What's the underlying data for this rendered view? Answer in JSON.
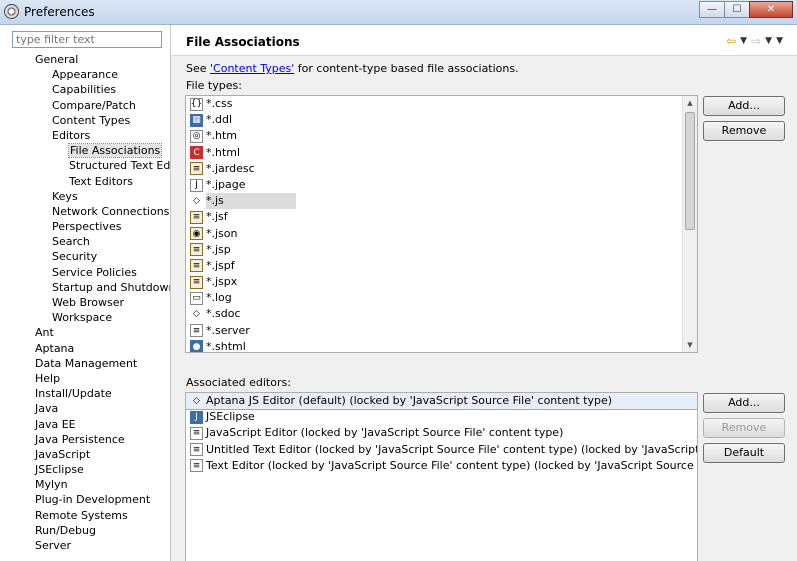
{
  "window": {
    "title": "Preferences"
  },
  "filter": {
    "placeholder": "type filter text"
  },
  "tree": [
    {
      "label": "General",
      "indent": 1
    },
    {
      "label": "Appearance",
      "indent": 2
    },
    {
      "label": "Capabilities",
      "indent": 2
    },
    {
      "label": "Compare/Patch",
      "indent": 2
    },
    {
      "label": "Content Types",
      "indent": 2
    },
    {
      "label": "Editors",
      "indent": 2
    },
    {
      "label": "File Associations",
      "indent": 3,
      "selected": true
    },
    {
      "label": "Structured Text Editors",
      "indent": 3
    },
    {
      "label": "Text Editors",
      "indent": 3
    },
    {
      "label": "Keys",
      "indent": 2
    },
    {
      "label": "Network Connections",
      "indent": 2
    },
    {
      "label": "Perspectives",
      "indent": 2
    },
    {
      "label": "Search",
      "indent": 2
    },
    {
      "label": "Security",
      "indent": 2
    },
    {
      "label": "Service Policies",
      "indent": 2
    },
    {
      "label": "Startup and Shutdown",
      "indent": 2
    },
    {
      "label": "Web Browser",
      "indent": 2
    },
    {
      "label": "Workspace",
      "indent": 2
    },
    {
      "label": "Ant",
      "indent": 1
    },
    {
      "label": "Aptana",
      "indent": 1
    },
    {
      "label": "Data Management",
      "indent": 1
    },
    {
      "label": "Help",
      "indent": 1
    },
    {
      "label": "Install/Update",
      "indent": 1
    },
    {
      "label": "Java",
      "indent": 1
    },
    {
      "label": "Java EE",
      "indent": 1
    },
    {
      "label": "Java Persistence",
      "indent": 1
    },
    {
      "label": "JavaScript",
      "indent": 1
    },
    {
      "label": "JSEclipse",
      "indent": 1
    },
    {
      "label": "Mylyn",
      "indent": 1
    },
    {
      "label": "Plug-in Development",
      "indent": 1
    },
    {
      "label": "Remote Systems",
      "indent": 1
    },
    {
      "label": "Run/Debug",
      "indent": 1
    },
    {
      "label": "Server",
      "indent": 1
    }
  ],
  "page": {
    "title": "File Associations",
    "desc_prefix": "See ",
    "desc_link": "'Content Types'",
    "desc_suffix": " for content-type based file associations.",
    "file_types_label": "File types:",
    "assoc_label": "Associated editors:"
  },
  "file_types": [
    {
      "name": "*.css",
      "icon": "css-file-icon"
    },
    {
      "name": "*.ddl",
      "icon": "ddl-file-icon"
    },
    {
      "name": "*.htm",
      "icon": "htm-file-icon"
    },
    {
      "name": "*.html",
      "icon": "html-file-icon"
    },
    {
      "name": "*.jardesc",
      "icon": "jardesc-file-icon"
    },
    {
      "name": "*.jpage",
      "icon": "jpage-file-icon"
    },
    {
      "name": "*.js",
      "icon": "js-file-icon",
      "selected": true
    },
    {
      "name": "*.jsf",
      "icon": "jsf-file-icon"
    },
    {
      "name": "*.json",
      "icon": "json-file-icon"
    },
    {
      "name": "*.jsp",
      "icon": "jsp-file-icon"
    },
    {
      "name": "*.jspf",
      "icon": "jspf-file-icon"
    },
    {
      "name": "*.jspx",
      "icon": "jspx-file-icon"
    },
    {
      "name": "*.log",
      "icon": "log-file-icon"
    },
    {
      "name": "*.sdoc",
      "icon": "sdoc-file-icon"
    },
    {
      "name": "*.server",
      "icon": "server-file-icon"
    },
    {
      "name": "*.shtml",
      "icon": "shtml-file-icon"
    }
  ],
  "editors": [
    {
      "name": "Aptana JS Editor (default) (locked by 'JavaScript Source File' content type)",
      "icon": "aptana-editor-icon",
      "selected": true
    },
    {
      "name": "JSEclipse",
      "icon": "jseclipse-editor-icon"
    },
    {
      "name": "JavaScript Editor (locked by 'JavaScript Source File' content type)",
      "icon": "javascript-editor-icon"
    },
    {
      "name": "Untitled Text Editor (locked by 'JavaScript Source File' content type) (locked by 'JavaScript Source File' content type)",
      "icon": "untitled-editor-icon"
    },
    {
      "name": "Text Editor (locked by 'JavaScript Source File' content type) (locked by 'JavaScript Source File' content type)",
      "icon": "text-editor-icon"
    }
  ],
  "buttons": {
    "add_file": "Add...",
    "remove_file": "Remove",
    "add_editor": "Add...",
    "remove_editor": "Remove",
    "default_editor": "Default"
  },
  "nav": {
    "back": "⇦",
    "forward": "⇨",
    "dropdown": "▼"
  },
  "window_controls": {
    "minimize": "—",
    "maximize": "☐",
    "close": "✕"
  }
}
